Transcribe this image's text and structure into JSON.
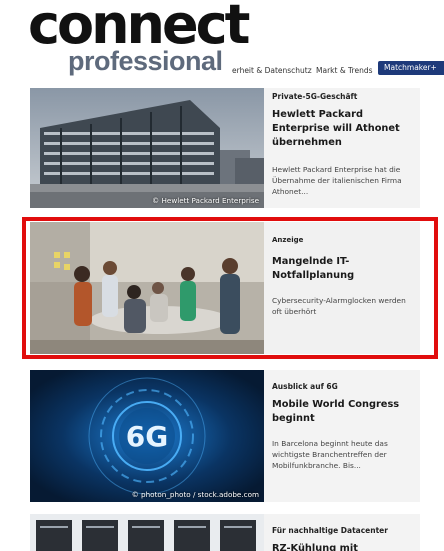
{
  "header": {
    "logo_top": "connect",
    "logo_bottom": "professional",
    "nav_items": [
      "erheit & Datenschutz",
      "Markt & Trends"
    ],
    "nav_button": "Matchmaker+"
  },
  "articles": [
    {
      "kicker": "Private-5G-Geschäft",
      "headline": "Hewlett Packard Enterprise will Athonet übernehmen",
      "teaser": "Hewlett Packard Enterprise hat die Übernahme der italienischen Firma Athonet...",
      "credit": "© Hewlett Packard Enterprise"
    },
    {
      "kicker": "Anzeige",
      "headline": "Mangelnde IT-Notfallplanung",
      "teaser": "Cybersecurity-Alarmglocken werden oft überhört",
      "credit": ""
    },
    {
      "kicker": "Ausblick auf 6G",
      "headline": "Mobile World Congress beginnt",
      "teaser": "In Barcelona beginnt heute das wichtigste Branchentreffen der Mobilfunkbranche. Bis...",
      "credit": "© photon_photo / stock.adobe.com",
      "image_text": "6G"
    },
    {
      "kicker": "Für nachhaltige Datacenter",
      "headline": "RZ-Kühlung mit"
    }
  ],
  "colors": {
    "nav_button_bg": "#1e3a7a",
    "highlight_border": "#e10d0d",
    "card_bg": "#f3f3f3"
  }
}
